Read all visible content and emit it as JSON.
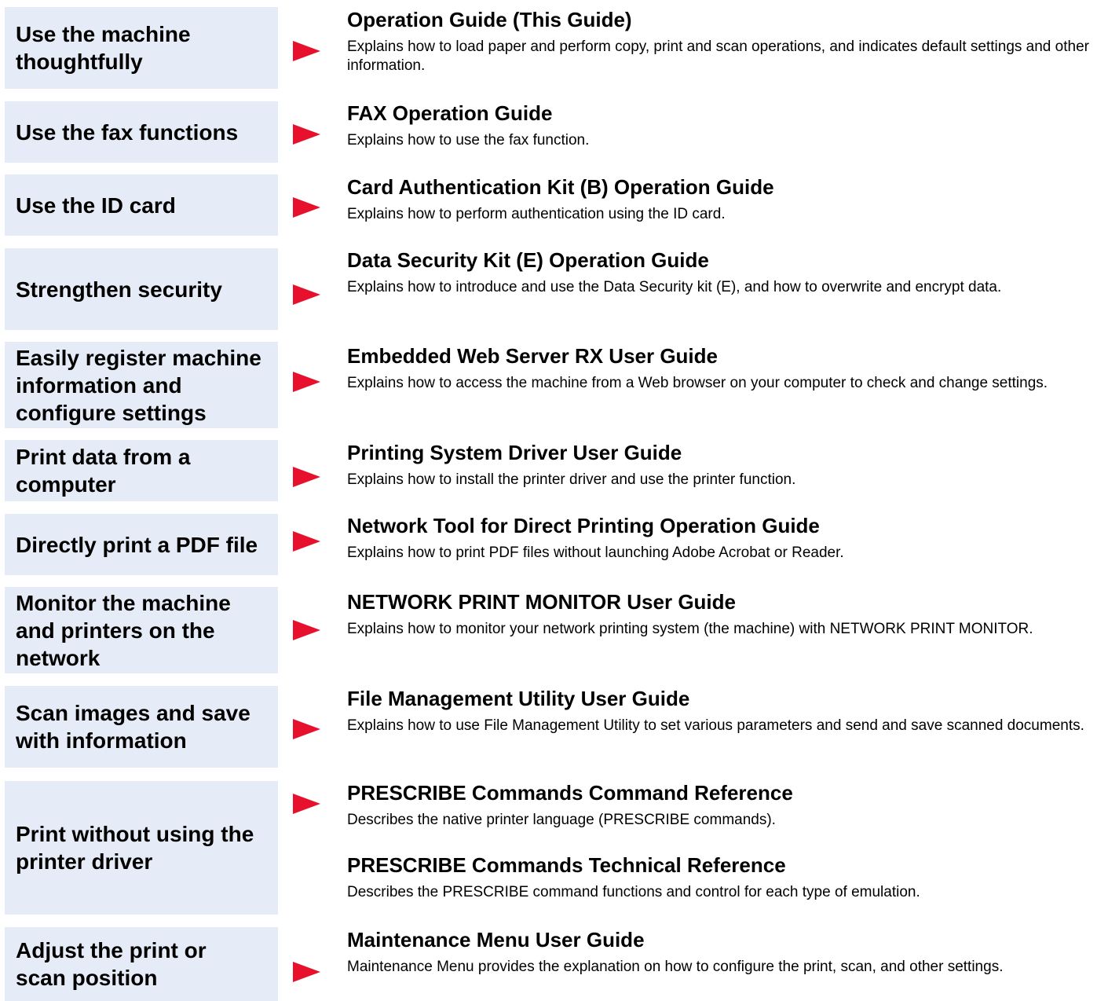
{
  "rows": [
    {
      "task": "Use the machine thoughtfully",
      "guides": [
        {
          "title": "Operation Guide (This Guide)",
          "description": "Explains how to load paper and perform copy, print and scan operations, and indicates default settings and other information."
        }
      ]
    },
    {
      "task": "Use the fax functions",
      "guides": [
        {
          "title": "FAX Operation Guide",
          "description": "Explains how to use the fax function."
        }
      ]
    },
    {
      "task": "Use the ID card",
      "guides": [
        {
          "title": "Card Authentication Kit (B) Operation Guide",
          "description": "Explains how to perform authentication using the ID card."
        }
      ]
    },
    {
      "task": "Strengthen security",
      "guides": [
        {
          "title": "Data Security Kit (E) Operation Guide",
          "description": "Explains how to introduce and use the Data Security kit (E), and how to overwrite and encrypt data."
        }
      ]
    },
    {
      "task": "Easily register machine information and configure settings",
      "guides": [
        {
          "title": "Embedded Web Server RX User Guide",
          "description": "Explains how to access the machine from a Web browser on your computer to check and change settings."
        }
      ]
    },
    {
      "task": "Print data from a computer",
      "guides": [
        {
          "title": "Printing System Driver User Guide",
          "description": "Explains how to install the printer driver and use the printer function."
        }
      ]
    },
    {
      "task": "Directly print a PDF file",
      "guides": [
        {
          "title": "Network Tool for Direct Printing Operation Guide",
          "description": "Explains how to print PDF files without launching Adobe Acrobat or Reader."
        }
      ]
    },
    {
      "task": "Monitor the machine and printers on the network",
      "guides": [
        {
          "title": "NETWORK PRINT MONITOR User Guide",
          "description": "Explains how to monitor your network printing system (the machine) with NETWORK PRINT MONITOR."
        }
      ]
    },
    {
      "task": "Scan images and save with information",
      "guides": [
        {
          "title": "File Management Utility User Guide",
          "description": "Explains how to use File Management Utility to set various parameters and send and save scanned documents."
        }
      ]
    },
    {
      "task": "Print without using the printer driver",
      "guides": [
        {
          "title": "PRESCRIBE Commands Command Reference",
          "description": "Describes the native printer language (PRESCRIBE commands)."
        },
        {
          "title": "PRESCRIBE Commands Technical Reference",
          "description": "Describes the PRESCRIBE command functions and control for each type of emulation."
        }
      ]
    },
    {
      "task": "Adjust the print or scan position",
      "guides": [
        {
          "title": "Maintenance Menu User Guide",
          "description": "Maintenance Menu provides the explanation on how to configure the print, scan, and other settings."
        }
      ]
    }
  ],
  "colors": {
    "task_box_background": "#e6ecf7",
    "arrow": "#e8112d",
    "text": "#000000"
  }
}
